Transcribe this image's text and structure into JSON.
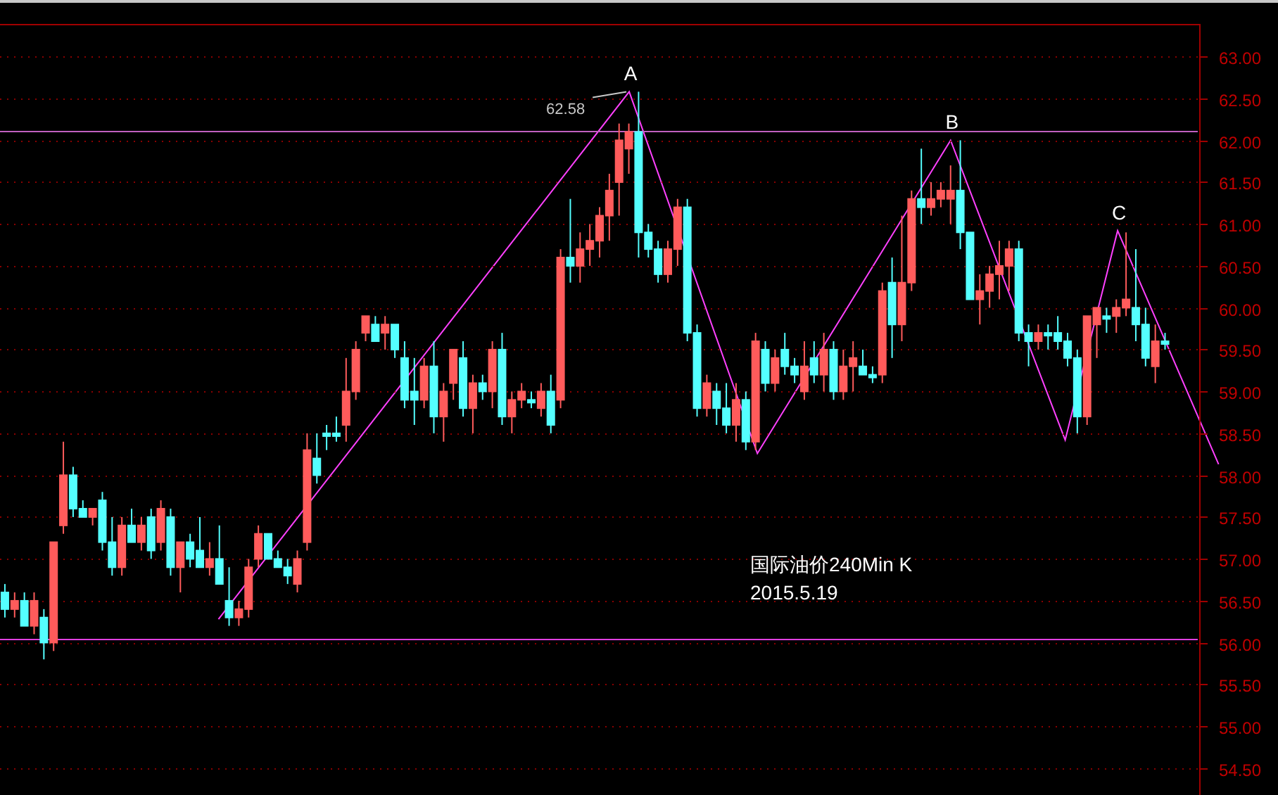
{
  "chart": {
    "chart_data": {
      "type": "candlestick",
      "grid": true,
      "ylim": [
        54.18,
        63.39
      ],
      "categories": [
        null,
        null,
        null,
        null,
        null,
        null,
        null,
        null,
        null,
        null,
        null,
        null,
        null,
        null,
        null,
        null,
        null,
        null,
        null,
        null,
        null,
        null,
        null,
        null,
        null,
        null,
        null,
        null,
        null,
        null,
        null,
        null,
        null,
        null,
        null,
        null,
        null,
        null,
        null,
        null,
        null,
        null,
        null,
        null,
        null,
        null,
        null,
        null,
        null,
        null,
        null,
        null,
        null,
        null,
        null,
        null,
        null,
        null,
        null,
        null,
        null,
        null,
        null,
        null,
        null,
        null,
        null,
        null,
        null,
        null,
        null,
        null,
        null,
        null,
        null,
        null,
        null,
        null,
        null,
        null,
        null,
        null,
        null,
        null,
        null,
        null,
        null,
        null,
        null,
        null,
        null,
        null,
        null,
        null,
        null,
        null,
        null,
        null,
        null,
        null,
        null,
        null,
        null,
        null,
        null,
        null,
        null,
        null,
        null,
        null,
        null,
        null,
        null,
        null,
        null,
        null,
        null,
        null,
        null,
        null,
        null,
        null,
        null
      ],
      "ref_lines": [
        {
          "axis": "y",
          "value": 62.11,
          "color": "#c060c0"
        },
        {
          "axis": "y",
          "value": 56.04,
          "color": "#e040e0"
        }
      ],
      "yticks": [
        {
          "value": 63,
          "label": "63.00"
        },
        {
          "value": 62.5,
          "label": "62.50"
        },
        {
          "value": 62,
          "label": "62.00"
        },
        {
          "value": 61.5,
          "label": "61.50"
        },
        {
          "value": 61,
          "label": "61.00"
        },
        {
          "value": 60.5,
          "label": "60.50"
        },
        {
          "value": 60,
          "label": "60.00"
        },
        {
          "value": 59.5,
          "label": "59.50"
        },
        {
          "value": 59,
          "label": "59.00"
        },
        {
          "value": 58.5,
          "label": "58.50"
        },
        {
          "value": 58,
          "label": "58.00"
        },
        {
          "value": 57.5,
          "label": "57.50"
        },
        {
          "value": 57,
          "label": "57.00"
        },
        {
          "value": 56.5,
          "label": "56.50"
        },
        {
          "value": 56,
          "label": "56.00"
        },
        {
          "value": 55.5,
          "label": "55.50"
        },
        {
          "value": 55,
          "label": "55.00"
        },
        {
          "value": 54.5,
          "label": "54.50"
        }
      ],
      "ohlc": [
        [
          56.6,
          56.7,
          56.3,
          56.4
        ],
        [
          56.4,
          56.6,
          56.3,
          56.5
        ],
        [
          56.5,
          56.6,
          56.2,
          56.2
        ],
        [
          56.2,
          56.6,
          56.1,
          56.5
        ],
        [
          56.3,
          56.4,
          55.8,
          56.0
        ],
        [
          56.0,
          57.2,
          55.9,
          57.2
        ],
        [
          57.4,
          58.4,
          57.3,
          58.0
        ],
        [
          58.0,
          58.1,
          57.5,
          57.6
        ],
        [
          57.6,
          57.7,
          57.5,
          57.5
        ],
        [
          57.5,
          57.6,
          57.4,
          57.6
        ],
        [
          57.7,
          57.8,
          57.1,
          57.2
        ],
        [
          57.2,
          57.5,
          56.8,
          56.9
        ],
        [
          56.9,
          57.5,
          56.8,
          57.4
        ],
        [
          57.4,
          57.6,
          57.2,
          57.2
        ],
        [
          57.2,
          57.5,
          57.1,
          57.4
        ],
        [
          57.5,
          57.6,
          57.0,
          57.1
        ],
        [
          57.2,
          57.7,
          57.1,
          57.6
        ],
        [
          57.5,
          57.6,
          56.8,
          56.9
        ],
        [
          56.9,
          57.2,
          56.6,
          57.2
        ],
        [
          57.2,
          57.3,
          56.9,
          57.0
        ],
        [
          57.1,
          57.5,
          56.9,
          56.9
        ],
        [
          56.9,
          57.2,
          56.8,
          57.0
        ],
        [
          57.0,
          57.4,
          56.7,
          56.7
        ],
        [
          56.5,
          56.9,
          56.2,
          56.3
        ],
        [
          56.3,
          56.5,
          56.2,
          56.4
        ],
        [
          56.4,
          57.0,
          56.3,
          56.9
        ],
        [
          57.0,
          57.4,
          56.9,
          57.3
        ],
        [
          57.3,
          57.3,
          57.0,
          57.0
        ],
        [
          57.0,
          57.1,
          56.9,
          56.9
        ],
        [
          56.9,
          57.0,
          56.7,
          56.8
        ],
        [
          56.7,
          57.1,
          56.6,
          57.0
        ],
        [
          57.2,
          58.5,
          57.1,
          58.3
        ],
        [
          58.2,
          58.5,
          57.9,
          58.0
        ],
        [
          58.5,
          58.6,
          58.3,
          58.5
        ],
        [
          58.5,
          58.7,
          58.4,
          58.5
        ],
        [
          58.6,
          59.4,
          58.4,
          59.0
        ],
        [
          59.0,
          59.6,
          58.9,
          59.5
        ],
        [
          59.7,
          59.9,
          59.6,
          59.9
        ],
        [
          59.8,
          59.9,
          59.6,
          59.6
        ],
        [
          59.7,
          59.9,
          59.5,
          59.8
        ],
        [
          59.8,
          59.8,
          59.4,
          59.5
        ],
        [
          59.4,
          59.6,
          58.8,
          58.9
        ],
        [
          59.0,
          59.4,
          58.6,
          58.9
        ],
        [
          58.9,
          59.4,
          58.8,
          59.3
        ],
        [
          59.3,
          59.6,
          58.5,
          58.7
        ],
        [
          58.7,
          59.1,
          58.4,
          59.0
        ],
        [
          59.1,
          59.5,
          58.9,
          59.5
        ],
        [
          59.4,
          59.6,
          58.7,
          58.8
        ],
        [
          58.8,
          59.2,
          58.5,
          59.1
        ],
        [
          59.1,
          59.2,
          58.9,
          59.0
        ],
        [
          59.0,
          59.6,
          58.8,
          59.5
        ],
        [
          59.5,
          59.7,
          58.6,
          58.7
        ],
        [
          58.7,
          59.0,
          58.5,
          58.9
        ],
        [
          58.9,
          59.1,
          58.8,
          59.0
        ],
        [
          58.9,
          59.0,
          58.8,
          58.9
        ],
        [
          58.8,
          59.1,
          58.7,
          59.0
        ],
        [
          59.0,
          59.2,
          58.5,
          58.6
        ],
        [
          58.9,
          60.7,
          58.8,
          60.6
        ],
        [
          60.6,
          61.3,
          60.3,
          60.5
        ],
        [
          60.5,
          60.9,
          60.3,
          60.7
        ],
        [
          60.7,
          61.0,
          60.5,
          60.8
        ],
        [
          60.8,
          61.2,
          60.6,
          61.1
        ],
        [
          61.1,
          61.6,
          60.8,
          61.4
        ],
        [
          61.5,
          62.2,
          61.1,
          62.0
        ],
        [
          61.9,
          62.2,
          61.6,
          62.1
        ],
        [
          62.1,
          62.58,
          60.6,
          60.9
        ],
        [
          60.9,
          61.0,
          60.6,
          60.7
        ],
        [
          60.7,
          60.8,
          60.3,
          60.4
        ],
        [
          60.4,
          60.8,
          60.3,
          60.7
        ],
        [
          60.7,
          61.3,
          60.5,
          61.2
        ],
        [
          61.2,
          61.3,
          59.6,
          59.7
        ],
        [
          59.7,
          59.8,
          58.7,
          58.8
        ],
        [
          58.8,
          59.2,
          58.7,
          59.1
        ],
        [
          59.0,
          59.1,
          58.6,
          58.8
        ],
        [
          58.8,
          59.1,
          58.5,
          58.6
        ],
        [
          58.6,
          59.1,
          58.4,
          58.9
        ],
        [
          58.9,
          59.0,
          58.3,
          58.4
        ],
        [
          58.4,
          59.7,
          58.3,
          59.6
        ],
        [
          59.5,
          59.6,
          59.0,
          59.1
        ],
        [
          59.1,
          59.5,
          59.0,
          59.4
        ],
        [
          59.5,
          59.7,
          59.2,
          59.3
        ],
        [
          59.3,
          59.4,
          59.1,
          59.2
        ],
        [
          59.0,
          59.6,
          58.9,
          59.3
        ],
        [
          59.4,
          59.6,
          59.1,
          59.2
        ],
        [
          59.2,
          59.7,
          59.0,
          59.5
        ],
        [
          59.5,
          59.6,
          58.9,
          59.0
        ],
        [
          59.0,
          59.5,
          58.9,
          59.3
        ],
        [
          59.3,
          59.6,
          59.0,
          59.4
        ],
        [
          59.3,
          59.5,
          59.2,
          59.2
        ],
        [
          59.2,
          59.3,
          59.1,
          59.2
        ],
        [
          59.2,
          60.3,
          59.1,
          60.2
        ],
        [
          60.3,
          60.6,
          59.4,
          59.8
        ],
        [
          59.8,
          61.1,
          59.6,
          60.3
        ],
        [
          60.3,
          61.4,
          60.2,
          61.3
        ],
        [
          61.3,
          61.9,
          61.0,
          61.2
        ],
        [
          61.2,
          61.5,
          61.1,
          61.3
        ],
        [
          61.3,
          61.5,
          61.2,
          61.4
        ],
        [
          61.3,
          61.7,
          61.0,
          61.4
        ],
        [
          61.4,
          62.0,
          60.7,
          60.9
        ],
        [
          60.9,
          60.9,
          60.1,
          60.1
        ],
        [
          60.1,
          60.4,
          59.8,
          60.2
        ],
        [
          60.2,
          60.5,
          60.0,
          60.4
        ],
        [
          60.4,
          60.8,
          60.1,
          60.5
        ],
        [
          60.5,
          60.8,
          60.2,
          60.7
        ],
        [
          60.7,
          60.8,
          59.6,
          59.7
        ],
        [
          59.7,
          59.8,
          59.3,
          59.6
        ],
        [
          59.6,
          59.8,
          59.5,
          59.7
        ],
        [
          59.7,
          59.8,
          59.5,
          59.7
        ],
        [
          59.7,
          59.9,
          59.5,
          59.6
        ],
        [
          59.6,
          59.7,
          59.3,
          59.4
        ],
        [
          59.4,
          59.5,
          58.5,
          58.7
        ],
        [
          58.7,
          59.9,
          58.6,
          59.9
        ],
        [
          59.8,
          60.0,
          59.4,
          60.0
        ],
        [
          59.9,
          60.0,
          59.7,
          59.9
        ],
        [
          59.9,
          60.1,
          59.7,
          60.0
        ],
        [
          60.0,
          60.9,
          59.9,
          60.1
        ],
        [
          60.0,
          60.7,
          59.6,
          59.8
        ],
        [
          59.8,
          60.0,
          59.3,
          59.4
        ],
        [
          59.3,
          59.8,
          59.1,
          59.6
        ],
        [
          59.6,
          59.7,
          59.5,
          59.6
        ],
        null,
        null,
        null
      ]
    },
    "wave_labels": [
      "A",
      "B",
      "C"
    ],
    "peak_value": "62.58",
    "caption": [
      "国际油价240Min K",
      "2015.5.19"
    ]
  }
}
